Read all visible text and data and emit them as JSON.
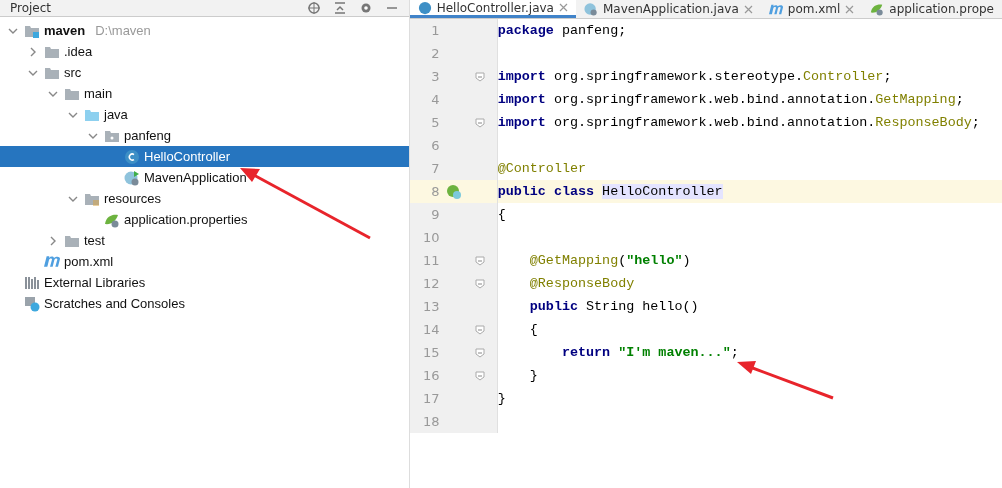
{
  "project_panel": {
    "title": "Project",
    "tree": [
      {
        "kind": "module",
        "label": "maven",
        "path": "D:\\maven",
        "selected": false,
        "expanded": true,
        "children": [
          {
            "kind": "folder",
            "label": ".idea",
            "selected": false,
            "expanded": false
          },
          {
            "kind": "folder",
            "label": "src",
            "selected": false,
            "expanded": true,
            "children": [
              {
                "kind": "folder",
                "label": "main",
                "selected": false,
                "expanded": true,
                "children": [
                  {
                    "kind": "source-folder",
                    "label": "java",
                    "selected": false,
                    "expanded": true,
                    "children": [
                      {
                        "kind": "package",
                        "label": "panfeng",
                        "selected": false,
                        "expanded": true,
                        "children": [
                          {
                            "kind": "class",
                            "label": "HelloController",
                            "selected": true
                          },
                          {
                            "kind": "spring-class",
                            "label": "MavenApplication",
                            "selected": false
                          }
                        ]
                      }
                    ]
                  },
                  {
                    "kind": "resources-folder",
                    "label": "resources",
                    "selected": false,
                    "expanded": true,
                    "children": [
                      {
                        "kind": "properties",
                        "label": "application.properties",
                        "selected": false
                      }
                    ]
                  }
                ]
              },
              {
                "kind": "folder",
                "label": "test",
                "selected": false,
                "expanded": false
              }
            ]
          },
          {
            "kind": "maven",
            "label": "pom.xml",
            "selected": false
          }
        ]
      },
      {
        "kind": "libraries",
        "label": "External Libraries",
        "selected": false
      },
      {
        "kind": "scratches",
        "label": "Scratches and Consoles",
        "selected": false
      }
    ]
  },
  "editor": {
    "tabs": [
      {
        "kind": "class",
        "label": "HelloController.java",
        "selected": true,
        "closable": true
      },
      {
        "kind": "spring-class",
        "label": "MavenApplication.java",
        "selected": false,
        "closable": true
      },
      {
        "kind": "maven",
        "label": "pom.xml",
        "selected": false,
        "closable": true
      },
      {
        "kind": "properties",
        "label": "application.prope",
        "selected": false,
        "closable": false
      }
    ],
    "lines": [
      {
        "number": "1",
        "fold": false,
        "current": false,
        "tokens": [
          {
            "kind": "keyword",
            "text": "package"
          },
          {
            "kind": "plain",
            "text": " panfeng;"
          }
        ]
      },
      {
        "number": "2",
        "fold": false,
        "current": false
      },
      {
        "number": "3",
        "fold": true,
        "current": false,
        "tokens": [
          {
            "kind": "keyword",
            "text": "import"
          },
          {
            "kind": "plain",
            "text": " org.springframework.stereotype."
          },
          {
            "kind": "annotation",
            "text": "Controller"
          },
          {
            "kind": "plain",
            "text": ";"
          }
        ]
      },
      {
        "number": "4",
        "fold": false,
        "current": false,
        "tokens": [
          {
            "kind": "keyword",
            "text": "import"
          },
          {
            "kind": "plain",
            "text": " org.springframework.web.bind.annotation."
          },
          {
            "kind": "annotation",
            "text": "GetMapping"
          },
          {
            "kind": "plain",
            "text": ";"
          }
        ]
      },
      {
        "number": "5",
        "fold": true,
        "current": false,
        "tokens": [
          {
            "kind": "keyword",
            "text": "import"
          },
          {
            "kind": "plain",
            "text": " org.springframework.web.bind.annotation."
          },
          {
            "kind": "annotation",
            "text": "ResponseBody"
          },
          {
            "kind": "plain",
            "text": ";"
          }
        ]
      },
      {
        "number": "6",
        "fold": false,
        "current": false
      },
      {
        "number": "7",
        "fold": false,
        "current": false,
        "tokens": [
          {
            "kind": "annotation",
            "text": "@Controller"
          }
        ]
      },
      {
        "number": "8",
        "fold": false,
        "current": true,
        "gutter_icon": true,
        "tokens": [
          {
            "kind": "keyword",
            "text": "public class "
          },
          {
            "kind": "highlight",
            "text": "HelloController"
          }
        ]
      },
      {
        "number": "9",
        "fold": false,
        "current": false,
        "tokens": [
          {
            "kind": "plain",
            "text": "{"
          }
        ]
      },
      {
        "number": "10",
        "fold": false,
        "current": false
      },
      {
        "number": "11",
        "fold": true,
        "current": false,
        "tokens": [
          {
            "kind": "annotation",
            "text": "    @GetMapping"
          },
          {
            "kind": "plain",
            "text": "("
          },
          {
            "kind": "string",
            "text": "\"hello\""
          },
          {
            "kind": "plain",
            "text": ")"
          }
        ]
      },
      {
        "number": "12",
        "fold": true,
        "current": false,
        "tokens": [
          {
            "kind": "annotation",
            "text": "    @ResponseBody"
          }
        ]
      },
      {
        "number": "13",
        "fold": false,
        "current": false,
        "tokens": [
          {
            "kind": "keyword",
            "text": "    public"
          },
          {
            "kind": "plain",
            "text": " String hello()"
          }
        ]
      },
      {
        "number": "14",
        "fold": true,
        "current": false,
        "tokens": [
          {
            "kind": "plain",
            "text": "    {"
          }
        ]
      },
      {
        "number": "15",
        "fold": true,
        "current": false,
        "tokens": [
          {
            "kind": "keyword",
            "text": "        return "
          },
          {
            "kind": "string",
            "text": "\"I'm maven...\""
          },
          {
            "kind": "plain",
            "text": ";"
          }
        ]
      },
      {
        "number": "16",
        "fold": true,
        "current": false,
        "tokens": [
          {
            "kind": "plain",
            "text": "    }"
          }
        ]
      },
      {
        "number": "17",
        "fold": false,
        "current": false,
        "tokens": [
          {
            "kind": "plain",
            "text": "}"
          }
        ]
      },
      {
        "number": "18",
        "fold": false,
        "current": false
      }
    ]
  }
}
